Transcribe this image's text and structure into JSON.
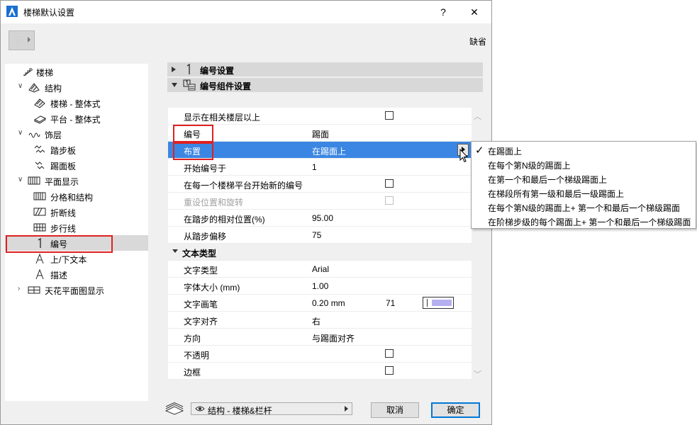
{
  "window": {
    "title": "楼梯默认设置",
    "help_label": "?",
    "close_label": "✕"
  },
  "favorites": {
    "default_label": "缺省"
  },
  "tree": [
    {
      "label": "楼梯",
      "icon": "stair-icon",
      "expander": "",
      "level": 0
    },
    {
      "label": "结构",
      "icon": "structure-icon",
      "expander": "∨",
      "level": 1
    },
    {
      "label": "楼梯 - 整体式",
      "icon": "monolithic-stair-icon",
      "expander": "",
      "level": 2
    },
    {
      "label": "平台 - 整体式",
      "icon": "monolithic-landing-icon",
      "expander": "",
      "level": 2
    },
    {
      "label": "饰层",
      "icon": "finish-icon",
      "expander": "∨",
      "level": 1
    },
    {
      "label": "踏步板",
      "icon": "tread-icon",
      "expander": "",
      "level": 2
    },
    {
      "label": "踢面板",
      "icon": "riser-icon",
      "expander": "",
      "level": 2
    },
    {
      "label": "平面显示",
      "icon": "floor-plan-display-icon",
      "expander": "∨",
      "level": 1
    },
    {
      "label": "分格和结构",
      "icon": "grid-structure-icon",
      "expander": "",
      "level": 2
    },
    {
      "label": "折断线",
      "icon": "break-line-icon",
      "expander": "",
      "level": 2
    },
    {
      "label": "步行线",
      "icon": "walking-line-icon",
      "expander": "",
      "level": 2
    },
    {
      "label": "编号",
      "icon": "numbering-icon",
      "expander": "",
      "level": 2
    },
    {
      "label": "上/下文本",
      "icon": "text-a-icon",
      "expander": "",
      "level": 2
    },
    {
      "label": "描述",
      "icon": "text-a-icon",
      "expander": "",
      "level": 2
    },
    {
      "label": "天花平面图显示",
      "icon": "ceiling-plan-icon",
      "expander": "›",
      "level": 1
    }
  ],
  "sections": {
    "numbering_settings": "编号设置",
    "numbering_component_settings": "编号组件设置"
  },
  "properties": [
    {
      "name": "显示在相关楼层以上",
      "value": "",
      "type": "check"
    },
    {
      "name": "编号",
      "value": "踢面",
      "type": "text"
    },
    {
      "name": "布置",
      "value": "在踢面上",
      "type": "select"
    },
    {
      "name": "开始编号于",
      "value": "1",
      "type": "text"
    },
    {
      "name": "在每一个楼梯平台开始新的编号",
      "value": "",
      "type": "check"
    },
    {
      "name": "重设位置和旋转",
      "value": "",
      "type": "check-disabled"
    },
    {
      "name": "在踏步的相对位置(%)",
      "value": "95.00",
      "type": "text"
    },
    {
      "name": "从踏步偏移",
      "value": "75",
      "type": "text"
    },
    {
      "name": "文本类型",
      "value": "",
      "type": "group"
    },
    {
      "name": "文字类型",
      "value": "Arial",
      "type": "text"
    },
    {
      "name": "字体大小 (mm)",
      "value": "1.00",
      "type": "text"
    },
    {
      "name": "文字画笔",
      "value": "0.20 mm",
      "value2": "71",
      "type": "pen"
    },
    {
      "name": "文字对齐",
      "value": "右",
      "type": "text"
    },
    {
      "name": "方向",
      "value": "与踢面对齐",
      "type": "text"
    },
    {
      "name": "不透明",
      "value": "",
      "type": "check"
    },
    {
      "name": "边框",
      "value": "",
      "type": "check"
    }
  ],
  "popup": {
    "selected_index": 0,
    "options": [
      "在踢面上",
      "在每个第N级的踢面上",
      "在第一个和最后一个梯级踢面上",
      "在梯段所有第一级和最后一级踢面上",
      "在每个第N级的踢面上+ 第一个和最后一个梯级踢面",
      "在阶梯步级的每个踢面上+ 第一个和最后一个梯级踢面"
    ]
  },
  "footer": {
    "layer_value": "结构 - 楼梯&栏杆",
    "cancel_label": "取消",
    "ok_label": "确定"
  },
  "colors": {
    "selection": "#3b86e3",
    "highlight_box": "#e02020",
    "pen_swatch": "#b5b0f0"
  }
}
